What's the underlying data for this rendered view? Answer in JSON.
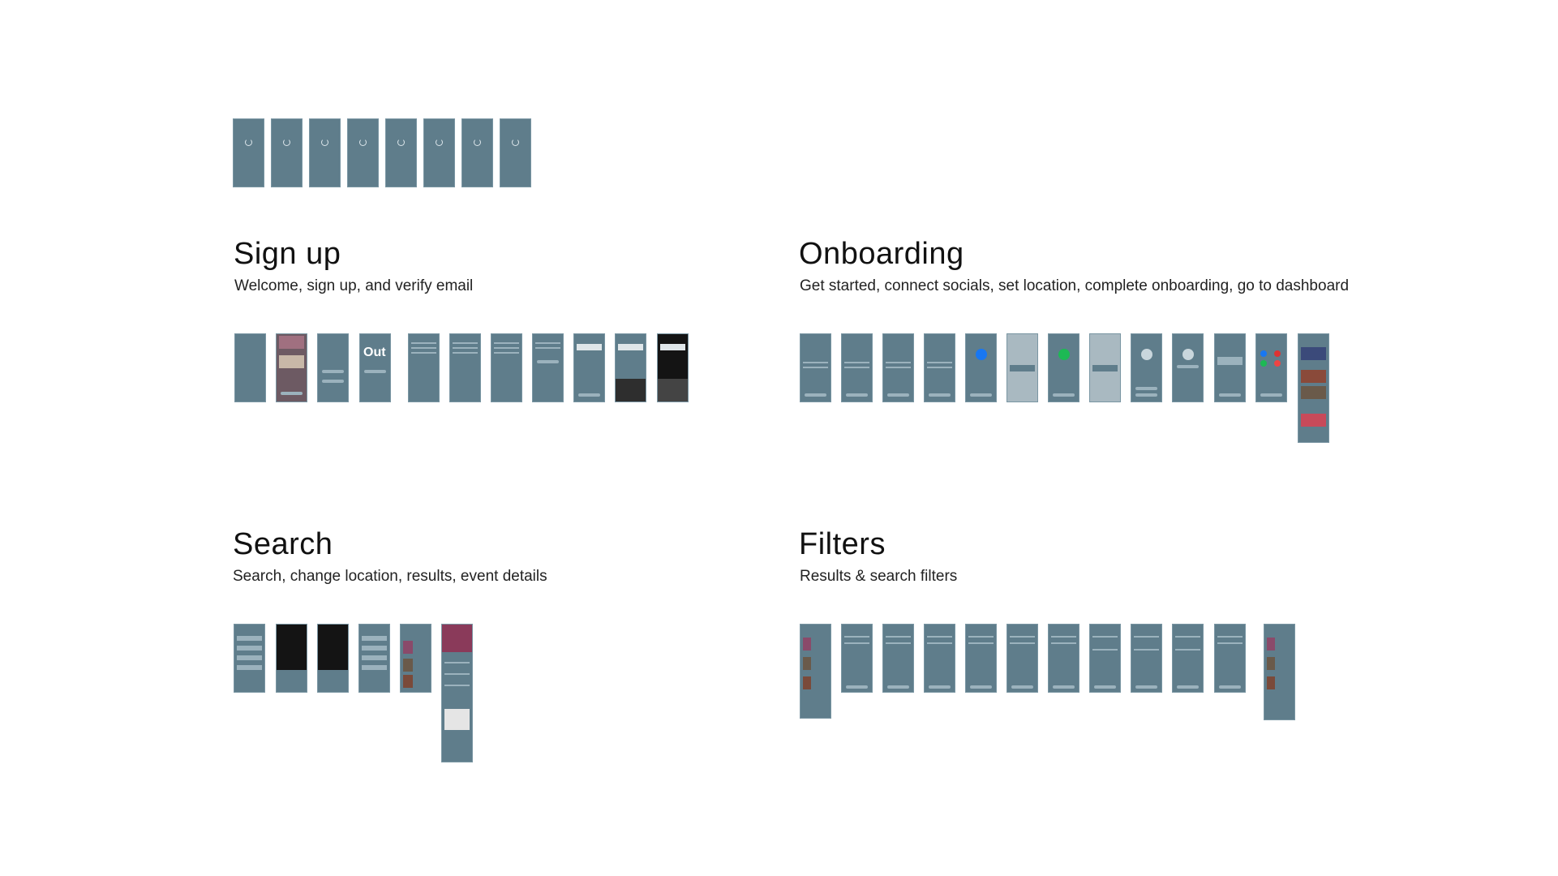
{
  "sections": {
    "signup": {
      "title": "Sign up",
      "subtitle": "Welcome, sign up, and verify email"
    },
    "onboarding": {
      "title": "Onboarding",
      "subtitle": "Get started, connect socials, set location, complete onboarding, go to dashboard"
    },
    "search": {
      "title": "Search",
      "subtitle": "Search, change location, results, event details"
    },
    "filters": {
      "title": "Filters",
      "subtitle": "Results & search filters"
    }
  },
  "thumbnails": {
    "loading": [
      "loading-1",
      "loading-2",
      "loading-3",
      "loading-4",
      "loading-5",
      "loading-6",
      "loading-7",
      "loading-8"
    ],
    "signup": [
      "splash",
      "welcome-photo",
      "welcome-map",
      "welcome-logo",
      "signup-form-1",
      "signup-form-2",
      "signup-form-3",
      "signup-form-4",
      "verify-email",
      "verify-email-keyboard",
      "verify-email-keyboard-dark"
    ],
    "onboarding": [
      "get-started",
      "connect-socials-1",
      "connect-socials-2",
      "connect-socials-3",
      "connect-facebook",
      "facebook-dialog",
      "connect-spotify",
      "spotify-dialog",
      "set-location-1",
      "set-location-2",
      "onboarding-complete",
      "connected-accounts",
      "dashboard"
    ],
    "search": [
      "search-categories",
      "search-location-dark",
      "search-location-dark-2",
      "search-categories-2",
      "search-results",
      "event-details"
    ],
    "filters": [
      "results-list",
      "filter-1",
      "filter-2",
      "filter-3",
      "filter-4",
      "filter-5",
      "filter-6",
      "filter-7",
      "filter-8",
      "filter-9",
      "filter-10",
      "filtered-results"
    ]
  },
  "colors": {
    "screen": "#5f7d8b",
    "facebook": "#1877f2",
    "spotify": "#1db954"
  },
  "icons": {
    "loading": "spinner-icon",
    "facebook": "facebook-icon",
    "spotify": "spotify-icon",
    "location": "globe-icon"
  }
}
